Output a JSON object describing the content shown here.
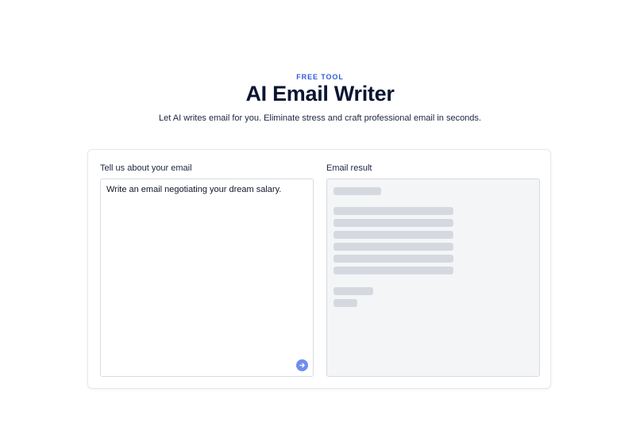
{
  "header": {
    "eyebrow": "FREE TOOL",
    "title": "AI Email Writer",
    "subtitle": "Let AI writes email for you. Eliminate stress and craft professional email in seconds."
  },
  "input_panel": {
    "label": "Tell us about your email",
    "value": "Write an email negotiating your dream salary.",
    "send_icon": "arrow-right-icon"
  },
  "result_panel": {
    "label": "Email result",
    "state": "loading"
  },
  "colors": {
    "accent": "#2f5bd8",
    "send_button": "#6f8df0",
    "skeleton": "#d5d9df",
    "result_bg": "#f4f5f7"
  }
}
